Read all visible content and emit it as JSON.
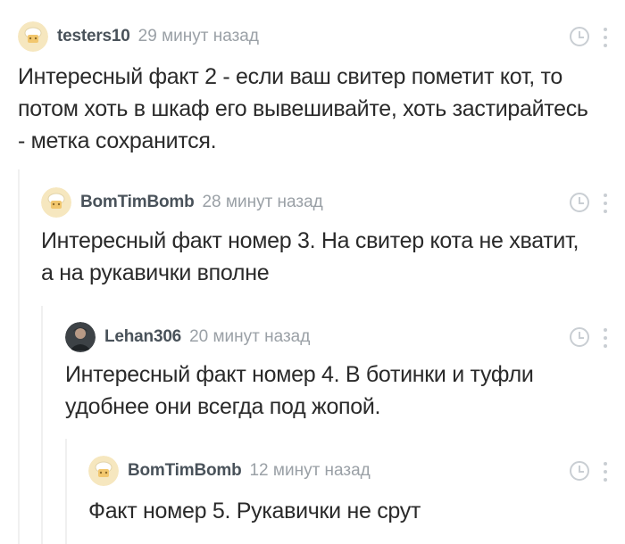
{
  "comments": [
    {
      "username": "testers10",
      "time": "29 минут назад",
      "lines": [
        "Интересный факт 2 - если ваш свитер пометит кот, то",
        "потом хоть в шкаф его вывешивайте,  хоть застирайтесь",
        "- метка сохранится."
      ],
      "avatar_icon": "chef-hat-avatar"
    },
    {
      "username": "BomTimBomb",
      "time": "28 минут назад",
      "lines": [
        "Интересный факт номер 3. На свитер кота не хватит,",
        "а на рукавички вполне"
      ],
      "avatar_icon": "chef-hat-avatar"
    },
    {
      "username": "Lehan306",
      "time": "20 минут назад",
      "lines": [
        "Интересный факт номер 4. В ботинки и туфли",
        "удобнее они всегда под жопой."
      ],
      "avatar_icon": "user-photo-avatar"
    },
    {
      "username": "BomTimBomb",
      "time": "12 минут назад",
      "lines": [
        "Факт номер 5. Рукавички не срут"
      ],
      "avatar_icon": "chef-hat-avatar"
    }
  ],
  "colors": {
    "username": "#49525a",
    "time": "#9aa0a6",
    "text": "#2a2a2a",
    "icon": "#c9ced3",
    "thread_line": "#f0f0f0",
    "avatar_bg": "#f6e7bf"
  }
}
